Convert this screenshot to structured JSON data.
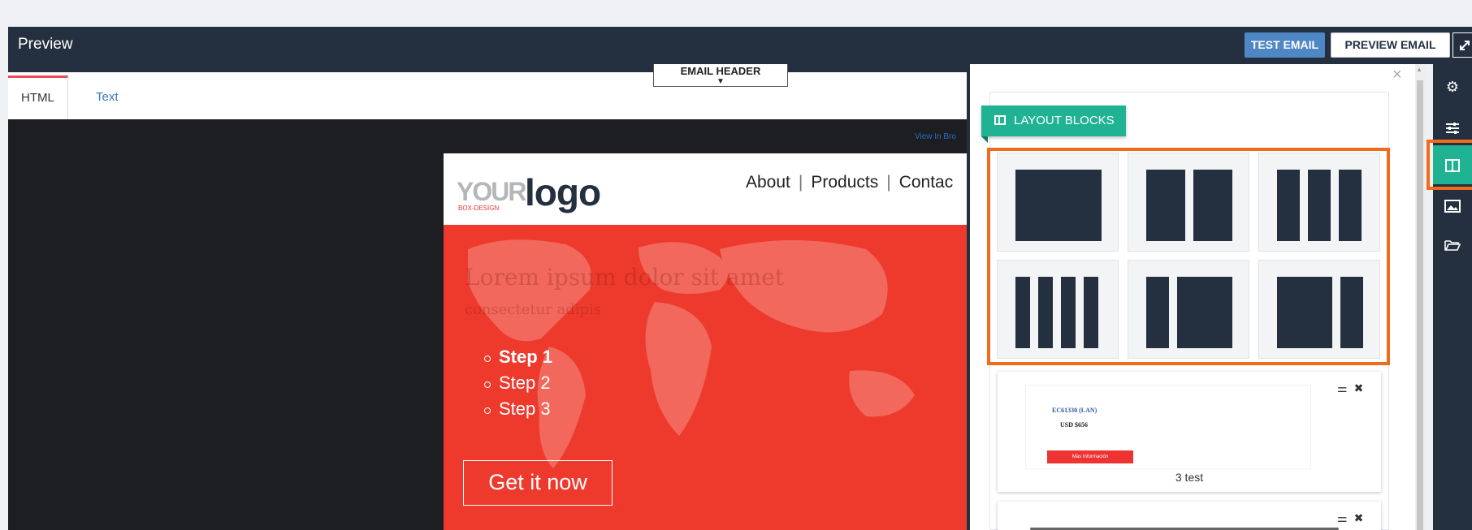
{
  "topbar": {
    "title": "Preview",
    "test_email_label": "TEST EMAIL",
    "preview_email_label": "PREVIEW EMAIL",
    "expand_icon": "expand-icon"
  },
  "editor": {
    "tabs": [
      {
        "label": "HTML"
      },
      {
        "label": "Text"
      }
    ],
    "active_tab": "HTML",
    "email_header_label": "EMAIL HEADER",
    "view_in_browser": "View In Bro"
  },
  "email": {
    "logo": {
      "part1": "YOUR",
      "part2": "logo",
      "sub": "BOX-DESIGN"
    },
    "nav": [
      "About",
      "Products",
      "Contac"
    ],
    "hero_heading": "Lorem ipsum dolor sit amet",
    "hero_sub": "consectetur adipis",
    "steps": [
      "Step 1",
      "Step 2",
      "Step 3"
    ],
    "cta_label": "Get it now",
    "hero_color": "#ee3a2d"
  },
  "panel": {
    "close": "×",
    "layout_blocks_label": "LAYOUT BLOCKS",
    "layout_options": [
      "1-column",
      "2-columns",
      "3-columns",
      "4-columns",
      "narrow-wide",
      "wide-narrow"
    ],
    "cards": [
      {
        "name": "3 test",
        "thumb_line1": "EC61330 (LAN)",
        "thumb_line2": "USD $656",
        "thumb_button": "Más Información"
      },
      {
        "name": "",
        "thumb_line1": "",
        "thumb_line2": "",
        "thumb_button": ""
      }
    ]
  },
  "side_rail": {
    "items": [
      "gear-icon",
      "sliders-icon",
      "columns-icon",
      "image-icon",
      "folder-icon"
    ],
    "active": "columns-icon"
  },
  "colors": {
    "accent": "#1fb293",
    "highlight": "#f26a1b",
    "dark": "#243040",
    "button_blue": "#4f87c4"
  }
}
